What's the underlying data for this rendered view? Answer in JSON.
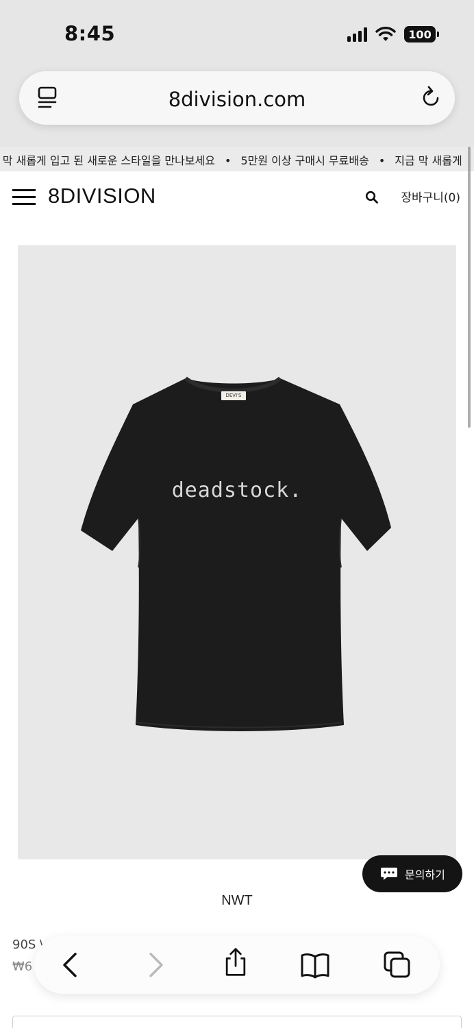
{
  "status_bar": {
    "time": "8:45",
    "battery": "100"
  },
  "browser": {
    "url": "8division.com"
  },
  "marquee": {
    "items": [
      "금 막 새롭게 입고 된 새로운 스타일을 만나보세요",
      "5만원 이상 구매시 무료배송",
      "지금 막 새롭게"
    ],
    "separator": "•"
  },
  "header": {
    "logo": "8DIVISION",
    "cart_label": "장바구니(0)"
  },
  "product": {
    "print_text": "deadstock.",
    "neck_label": "DEVI'S",
    "brand": "NWT",
    "name_partial": "90S \\",
    "price_partial": "₩6"
  },
  "chat_button": {
    "label": "문의하기"
  },
  "icons": {
    "menu": "hamburger-icon",
    "search": "search-icon",
    "tabs": "tabs-icon",
    "reload": "reload-icon",
    "back": "chevron-left-icon",
    "forward": "chevron-right-icon",
    "share": "share-icon",
    "bookmarks": "book-icon",
    "tab_overview": "tab-overview-icon",
    "chat": "chat-bubble-icon"
  },
  "colors": {
    "chrome_bg": "#e6e6e6",
    "image_bg": "#e8e8e8",
    "shirt": "#1b1b1b",
    "chat_button": "#141414"
  }
}
